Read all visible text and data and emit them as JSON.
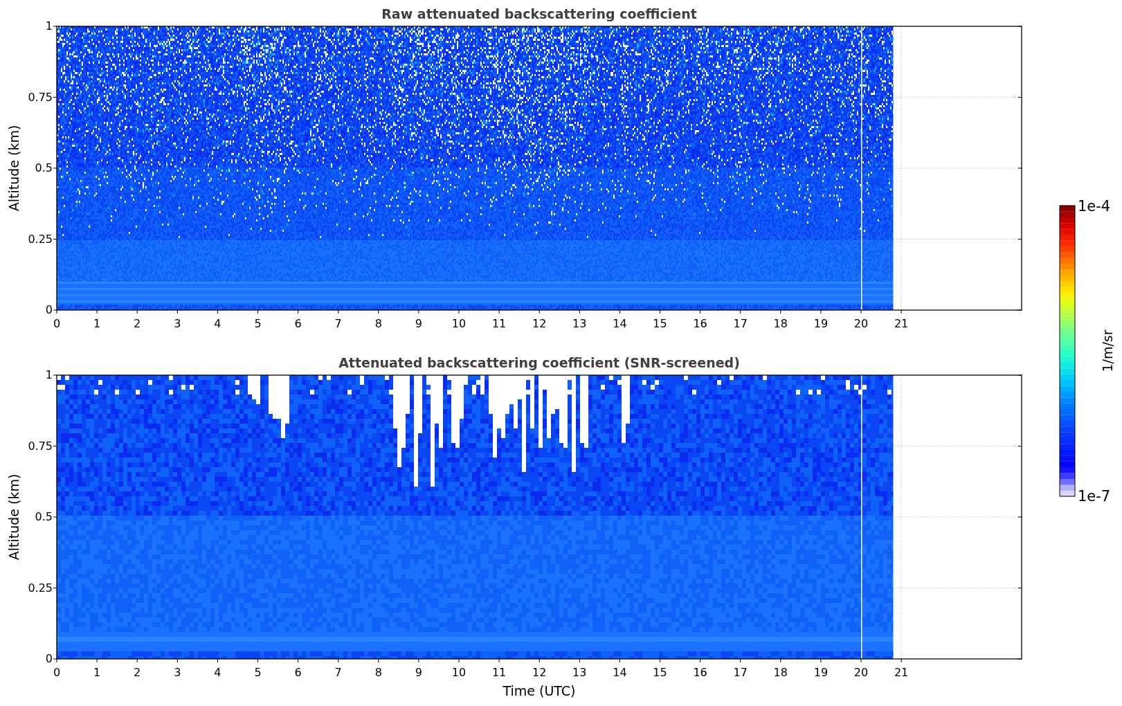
{
  "panels": [
    {
      "title": "Raw attenuated backscattering coefficient",
      "kind": "raw",
      "ylabel": "Altitude (km)",
      "yticks": [
        "1",
        "0.75",
        "0.5",
        "0.25",
        "0"
      ],
      "xticks": [
        "0",
        "1",
        "2",
        "3",
        "4",
        "5",
        "6",
        "7",
        "8",
        "9",
        "10",
        "11",
        "12",
        "13",
        "14",
        "15",
        "16",
        "17",
        "18",
        "19",
        "20",
        "21"
      ]
    },
    {
      "title": "Attenuated backscattering coefficient (SNR-screened)",
      "kind": "screened",
      "ylabel": "Altitude (km)",
      "yticks": [
        "1",
        "0.75",
        "0.5",
        "0.25",
        "0"
      ],
      "xticks": [
        "0",
        "1",
        "2",
        "3",
        "4",
        "5",
        "6",
        "7",
        "8",
        "9",
        "10",
        "11",
        "12",
        "13",
        "14",
        "15",
        "16",
        "17",
        "18",
        "19",
        "20",
        "21"
      ]
    }
  ],
  "xlabel": "Time (UTC)",
  "colorbar": {
    "label": "1/m/sr",
    "max_label": "1e-4",
    "min_label": "1e-7"
  }
}
